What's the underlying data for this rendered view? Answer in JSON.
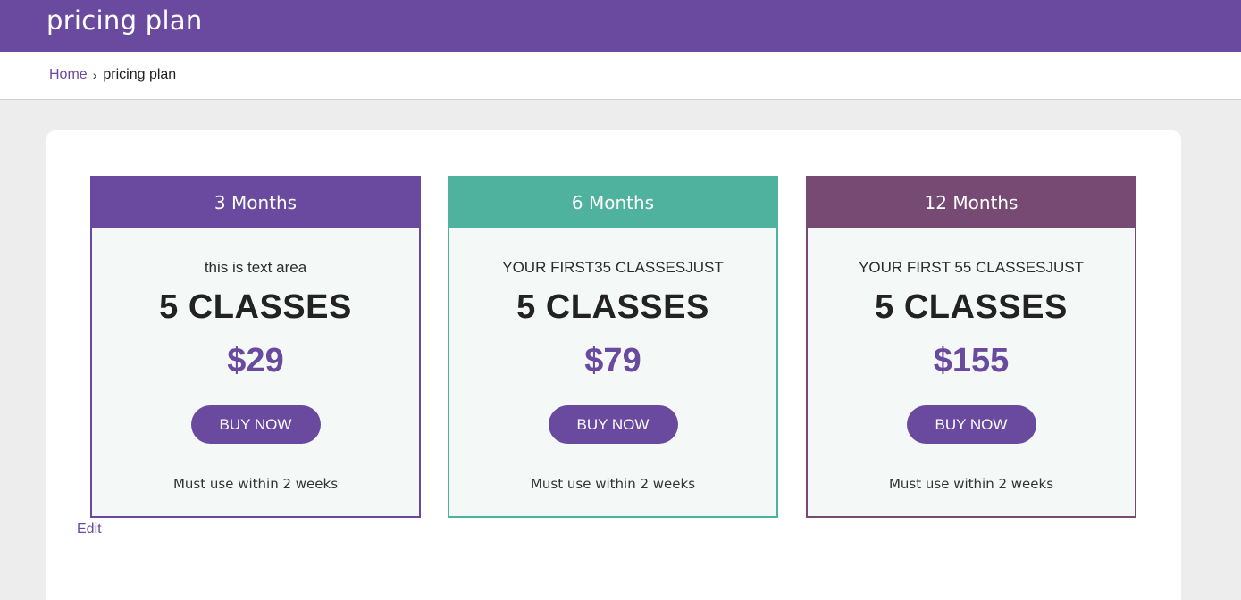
{
  "header": {
    "title": "pricing plan",
    "color": "#6a4a9e"
  },
  "breadcrumb": {
    "home": "Home",
    "separator": "›",
    "current": "pricing plan"
  },
  "plans": [
    {
      "name": "3 Months",
      "subtitle": "this is text area",
      "classes": "5 CLASSES",
      "price": "$29",
      "button": "BUY NOW",
      "note": "Must use within 2 weeks",
      "color": "#6a4a9e"
    },
    {
      "name": "6 Months",
      "subtitle": "YOUR FIRST35 CLASSESJUST",
      "classes": "5 CLASSES",
      "price": "$79",
      "button": "BUY NOW",
      "note": "Must use within 2 weeks",
      "color": "#4fb29e"
    },
    {
      "name": "12 Months",
      "subtitle": "YOUR FIRST 55 CLASSESJUST",
      "classes": "5 CLASSES",
      "price": "$155",
      "button": "BUY NOW",
      "note": "Must use within 2 weeks",
      "color": "#774a74"
    }
  ],
  "edit_label": "Edit"
}
